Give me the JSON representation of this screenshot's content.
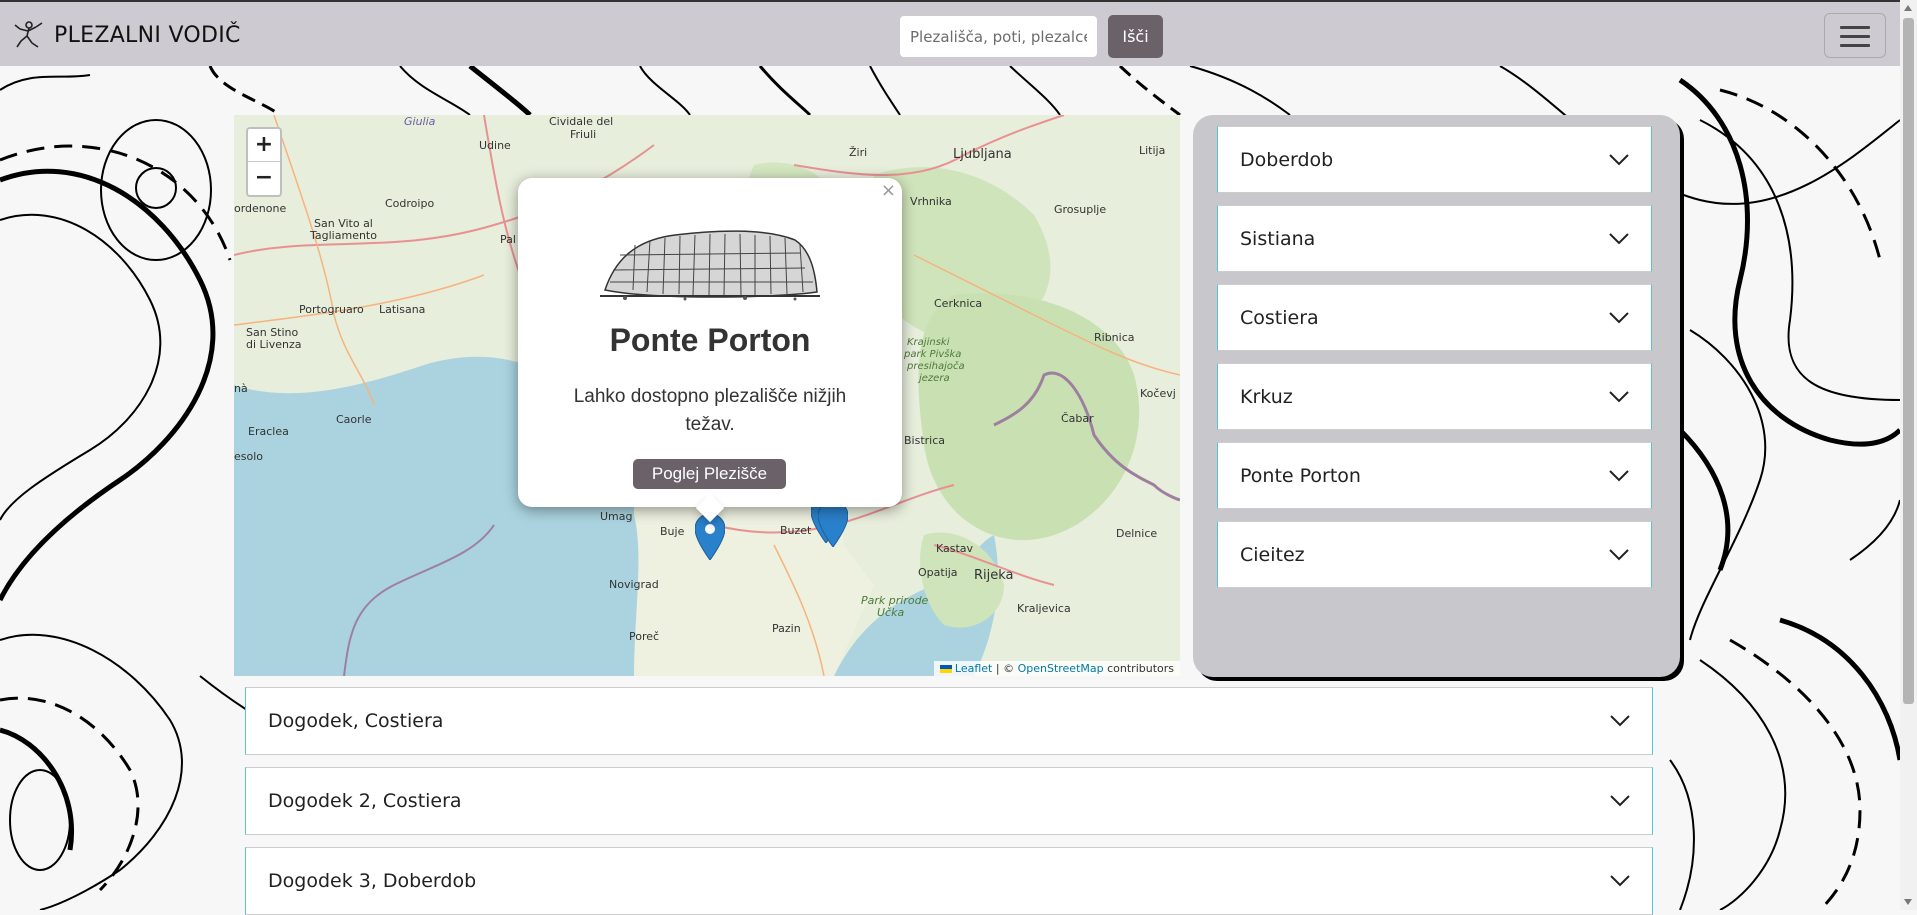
{
  "navbar": {
    "brand": "PLEZALNI VODIČ",
    "search_placeholder": "Plezališča, poti, plezalce",
    "search_button": "Išči"
  },
  "map": {
    "zoom_in": "+",
    "zoom_out": "−",
    "attribution": {
      "leaflet": "Leaflet",
      "separator": " | © ",
      "osm": "OpenStreetMap",
      "suffix": " contributors"
    },
    "place_labels": [
      "Udine",
      "Cividale del Friuli",
      "Giulia",
      "ordenone",
      "San Vito al Tagliamento",
      "Codroipo",
      "Portogruaro",
      "Latisana",
      "San Stino di Livenza",
      "Caorle",
      "Eraclea",
      "esolo",
      "Pal",
      "Žiri",
      "Ljubljana",
      "Litija",
      "Vrhnika",
      "Grosuplje",
      "Cerknica",
      "Krajinski park Pivška presihajoča jezera",
      "Ribnica",
      "Kočevj",
      "Čabar",
      "Bistrica",
      "Umag",
      "Buje",
      "Buzet",
      "Novigrad",
      "Poreč",
      "Pazin",
      "Kastav",
      "Opatija",
      "Rijeka",
      "Kraljevica",
      "Delnice",
      "Park prirode Učka"
    ],
    "popup": {
      "title": "Ponte Porton",
      "description": "Lahko dostopno plezališče nižjih težav.",
      "button": "Poglej Plezišče",
      "close": "×"
    }
  },
  "sidebar": {
    "crags": [
      {
        "label": "Doberdob"
      },
      {
        "label": "Sistiana"
      },
      {
        "label": "Costiera"
      },
      {
        "label": "Krkuz"
      },
      {
        "label": "Ponte Porton"
      },
      {
        "label": "Cieitez"
      }
    ]
  },
  "events": [
    {
      "label": "Dogodek, Costiera"
    },
    {
      "label": "Dogodek 2, Costiera"
    },
    {
      "label": "Dogodek 3, Doberdob"
    }
  ],
  "colors": {
    "navbar": "#cdcbd1",
    "button": "#6b6169",
    "sidepanel": "#c8c7cc",
    "marker": "#2a81cb"
  }
}
